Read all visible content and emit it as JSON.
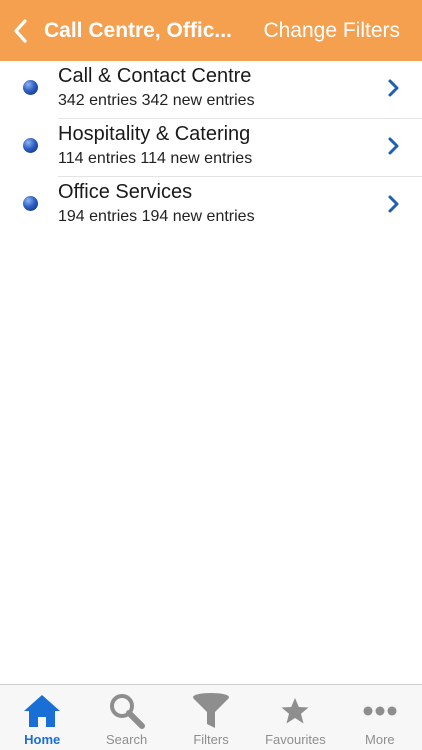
{
  "header": {
    "title": "Call Centre, Offic...",
    "action_label": "Change Filters"
  },
  "list": {
    "items": [
      {
        "title": "Call & Contact Centre",
        "subtitle": "342 entries 342 new entries"
      },
      {
        "title": "Hospitality & Catering",
        "subtitle": "114 entries 114 new entries"
      },
      {
        "title": "Office Services",
        "subtitle": "194 entries 194 new entries"
      }
    ]
  },
  "tabs": [
    {
      "label": "Home",
      "icon": "home-icon",
      "active": true
    },
    {
      "label": "Search",
      "icon": "search-icon",
      "active": false
    },
    {
      "label": "Filters",
      "icon": "filter-icon",
      "active": false
    },
    {
      "label": "Favourites",
      "icon": "star-icon",
      "active": false
    },
    {
      "label": "More",
      "icon": "more-icon",
      "active": false
    }
  ],
  "colors": {
    "nav_background": "#f5a04f",
    "accent_blue": "#1a6fd6",
    "chevron": "#1f5fb4",
    "inactive_tab": "#8e8e8e"
  }
}
